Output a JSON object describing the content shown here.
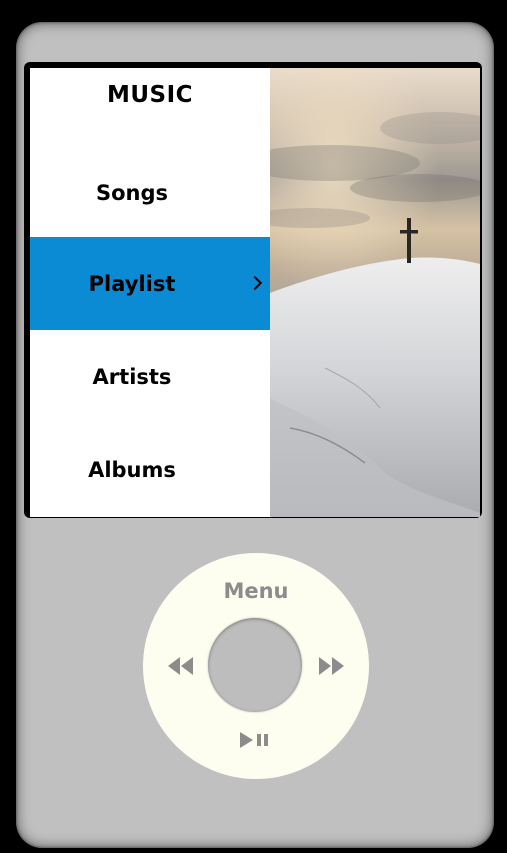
{
  "menu": {
    "title": "MUSIC",
    "items": [
      {
        "label": "Songs",
        "selected": false
      },
      {
        "label": "Playlist",
        "selected": true
      },
      {
        "label": "Artists",
        "selected": false
      },
      {
        "label": "Albums",
        "selected": false
      }
    ],
    "selected_color": "#0a8bd3"
  },
  "album_art": {
    "description_icon": "cross-on-snowy-hill-image"
  },
  "click_wheel": {
    "menu_label": "Menu",
    "buttons": {
      "previous": "rewind-icon",
      "next": "fast-forward-icon",
      "play_pause": "play-pause-icon",
      "center": "select-button"
    },
    "label_color": "#8c8c8c",
    "wheel_color": "#fdfdf0",
    "body_color": "#c0c0c0"
  }
}
